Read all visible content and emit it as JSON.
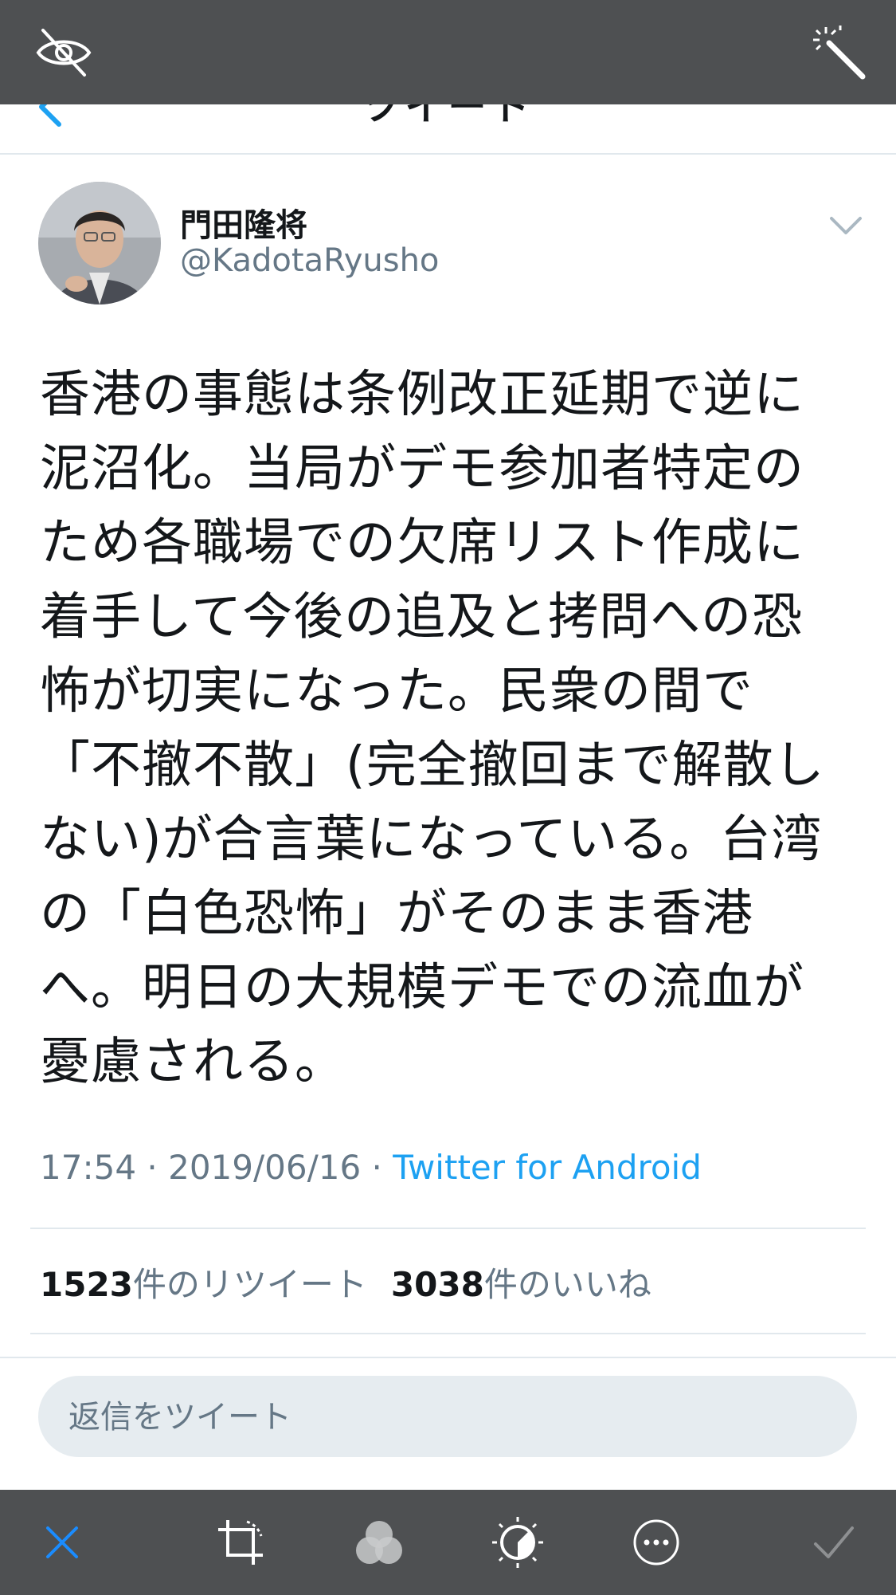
{
  "nav": {
    "title": "ツイート"
  },
  "author": {
    "name": "門田隆将",
    "handle": "@KadotaRyusho"
  },
  "tweet": {
    "text": "香港の事態は条例改正延期で逆に\n泥沼化。当局がデモ参加者特定の\nため各職場での欠席リスト作成に\n着手して今後の追及と拷問への恐\n怖が切実になった。民衆の間で\n「不撤不散」(完全撤回まで解散し\nない)が合言葉になっている。台湾\nの「白色恐怖」がそのまま香港\nへ。明日の大規模デモでの流血が\n憂慮される。",
    "time": "17:54",
    "date": "2019/06/16",
    "separator": " · ",
    "source": "Twitter for Android"
  },
  "stats": {
    "retweets_count": "1523",
    "retweets_label": "件のリツイート",
    "likes_count": "3038",
    "likes_label": "件のいいね"
  },
  "reply": {
    "placeholder": "返信をツイート"
  },
  "icons": {
    "top_left": "hidden-eye-icon",
    "top_right": "magic-wand-icon",
    "toolbar": [
      "close-icon",
      "crop-icon",
      "filters-icon",
      "adjust-icon",
      "more-icon",
      "done-icon"
    ]
  },
  "colors": {
    "accent": "#1da1f2",
    "secondary_text": "#657786",
    "editor_bar": "#4e5052"
  }
}
